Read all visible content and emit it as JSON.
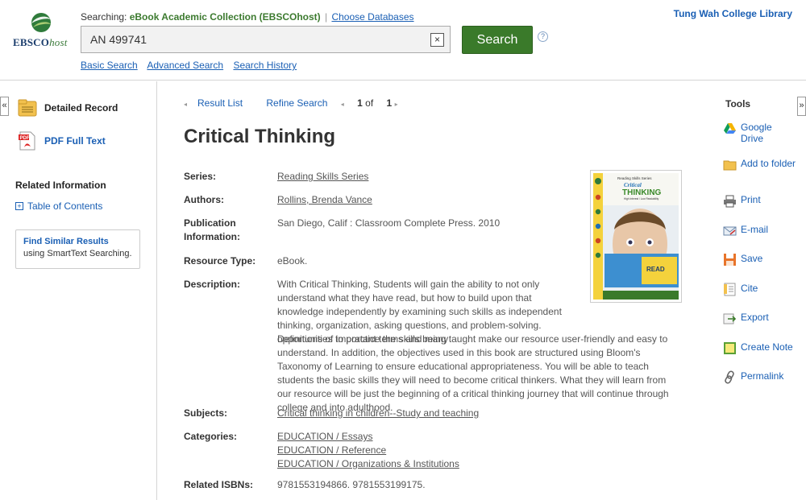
{
  "header": {
    "searching_prefix": "Searching:",
    "database": "eBook Academic Collection (EBSCOhost)",
    "separator": "|",
    "choose_databases": "Choose Databases",
    "search_value": "AN 499741",
    "search_button": "Search",
    "help_glyph": "?",
    "clear_glyph": "×",
    "links": {
      "basic": "Basic Search",
      "advanced": "Advanced Search",
      "history": "Search History"
    },
    "library": "Tung Wah College Library",
    "logo_main": "EBSCO",
    "logo_sub": "host"
  },
  "left": {
    "collapse_glyph": "«",
    "detailed_record": "Detailed Record",
    "pdf_full_text": "PDF Full Text",
    "related_title": "Related Information",
    "toc_glyph": "+",
    "toc": "Table of Contents",
    "similar_title": "Find Similar Results",
    "similar_sub": "using SmartText Searching."
  },
  "nav": {
    "result_list": "Result List",
    "refine_search": "Refine Search",
    "page_of_prefix": "1",
    "page_of_mid": "of",
    "page_of_suffix": "1",
    "prev_glyph": "◂",
    "next_glyph": "▸"
  },
  "record": {
    "title": "Critical Thinking",
    "series_label": "Series:",
    "series": "Reading Skills Series",
    "authors_label": "Authors:",
    "authors": "Rollins, Brenda Vance",
    "pub_label_1": "Publication",
    "pub_label_2": "Information:",
    "publication": "San Diego, Calif : Classroom Complete Press. 2010",
    "type_label": "Resource Type:",
    "resource_type": "eBook.",
    "desc_label": "Description:",
    "description": "With Critical Thinking, Students will gain the ability to not only understand what they have read, but how to build upon that knowledge independently by examining such skills as independent thinking, organization, asking questions, and problem-solving. Definitions of important terms and many opportunities to practice the skills being taught make our resource user-friendly and easy to understand. In addition, the objectives used in this book are structured using Bloom's Taxonomy of Learning to ensure educational appropriateness. You will be able to teach students the basic skills they will need to become critical thinkers. What they will learn from our resource will be just the beginning of a critical thinking journey that will continue through college and into adulthood.",
    "subjects_label": "Subjects:",
    "subjects": "Critical thinking in children--Study and teaching",
    "categories_label": "Categories:",
    "categories": [
      "EDUCATION / Essays",
      "EDUCATION / Reference",
      "EDUCATION / Organizations & Institutions"
    ],
    "isbn_label": "Related ISBNs:",
    "isbns": "9781553194866. 9781553199175.",
    "cover": {
      "series_text": "Reading Skills Series",
      "title_1": "Critical",
      "title_2": "THINKING",
      "subtitle": "High Interest / Low Readability",
      "book_text": "READ"
    }
  },
  "tools": {
    "collapse_glyph": "»",
    "title": "Tools",
    "items": [
      {
        "label": "Google Drive",
        "icon": "google-drive-icon"
      },
      {
        "label": "Add to folder",
        "icon": "folder-icon"
      },
      {
        "label": "Print",
        "icon": "printer-icon"
      },
      {
        "label": "E-mail",
        "icon": "email-icon"
      },
      {
        "label": "Save",
        "icon": "save-icon"
      },
      {
        "label": "Cite",
        "icon": "cite-icon"
      },
      {
        "label": "Export",
        "icon": "export-icon"
      },
      {
        "label": "Create Note",
        "icon": "note-icon"
      },
      {
        "label": "Permalink",
        "icon": "link-icon"
      }
    ]
  },
  "colors": {
    "accent_green": "#3a7a2a",
    "link_blue": "#1a5fb4",
    "db_green": "#3c7a2f"
  }
}
